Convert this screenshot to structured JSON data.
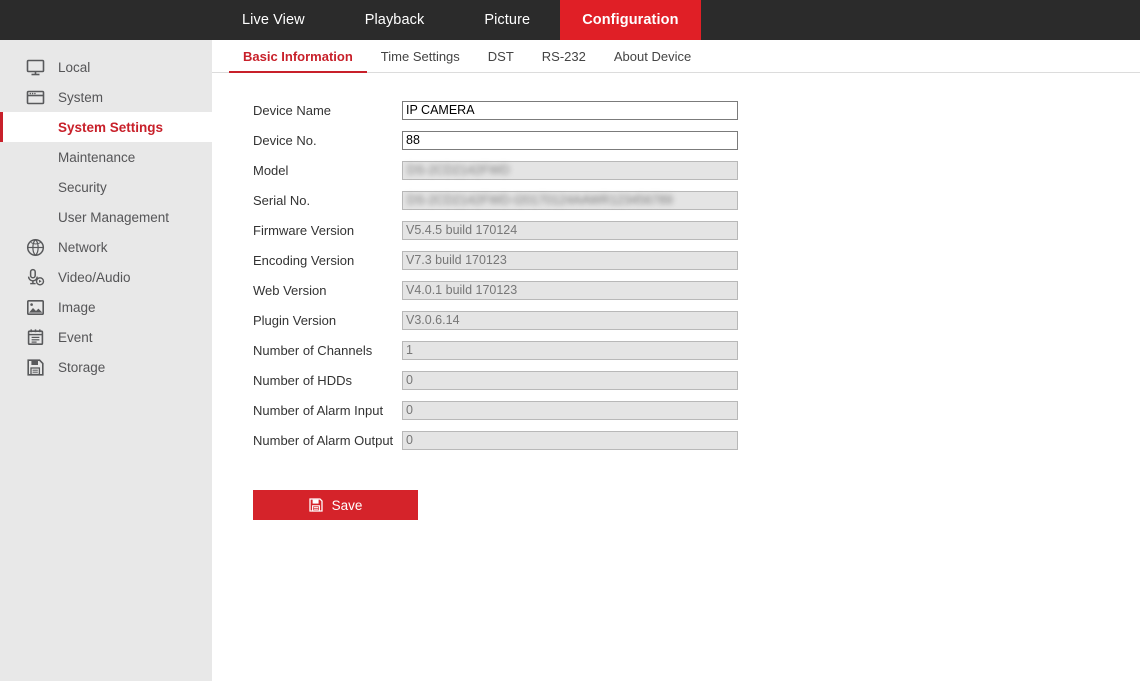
{
  "topnav": {
    "items": [
      {
        "label": "Live View",
        "active": false
      },
      {
        "label": "Playback",
        "active": false
      },
      {
        "label": "Picture",
        "active": false
      },
      {
        "label": "Configuration",
        "active": true
      }
    ],
    "background_color": "#2b2b2b",
    "active_color": "#e01f26"
  },
  "sidebar": {
    "background_color": "#e8e8e8",
    "active_color": "#c8202a",
    "items": [
      {
        "label": "Local",
        "icon": "monitor-icon",
        "level": "top"
      },
      {
        "label": "System",
        "icon": "window-icon",
        "level": "top"
      },
      {
        "label": "System Settings",
        "icon": "",
        "level": "sub",
        "active": true
      },
      {
        "label": "Maintenance",
        "icon": "",
        "level": "sub",
        "active": false
      },
      {
        "label": "Security",
        "icon": "",
        "level": "sub",
        "active": false
      },
      {
        "label": "User Management",
        "icon": "",
        "level": "sub",
        "active": false
      },
      {
        "label": "Network",
        "icon": "globe-icon",
        "level": "top"
      },
      {
        "label": "Video/Audio",
        "icon": "microphone-icon",
        "level": "top"
      },
      {
        "label": "Image",
        "icon": "picture-icon",
        "level": "top"
      },
      {
        "label": "Event",
        "icon": "calendar-icon",
        "level": "top"
      },
      {
        "label": "Storage",
        "icon": "floppy-disk-icon",
        "level": "top"
      }
    ]
  },
  "tabs": [
    {
      "label": "Basic Information",
      "active": true
    },
    {
      "label": "Time Settings",
      "active": false
    },
    {
      "label": "DST",
      "active": false
    },
    {
      "label": "RS-232",
      "active": false
    },
    {
      "label": "About Device",
      "active": false
    }
  ],
  "form": {
    "fields": [
      {
        "label": "Device Name",
        "value": "IP CAMERA",
        "disabled": false,
        "redacted": false
      },
      {
        "label": "Device No.",
        "value": "88",
        "disabled": false,
        "redacted": false
      },
      {
        "label": "Model",
        "value": "",
        "redacted_text": "DS-2CD2142FWD",
        "disabled": true,
        "redacted": true
      },
      {
        "label": "Serial No.",
        "value": "",
        "redacted_text": "DS-2CD2142FWD-I20170124AAWR123456789",
        "disabled": true,
        "redacted": true
      },
      {
        "label": "Firmware Version",
        "value": "V5.4.5 build 170124",
        "disabled": true,
        "redacted": false
      },
      {
        "label": "Encoding Version",
        "value": "V7.3 build 170123",
        "disabled": true,
        "redacted": false
      },
      {
        "label": "Web Version",
        "value": "V4.0.1 build 170123",
        "disabled": true,
        "redacted": false
      },
      {
        "label": "Plugin Version",
        "value": "V3.0.6.14",
        "disabled": true,
        "redacted": false
      },
      {
        "label": "Number of Channels",
        "value": "1",
        "disabled": true,
        "redacted": false
      },
      {
        "label": "Number of HDDs",
        "value": "0",
        "disabled": true,
        "redacted": false
      },
      {
        "label": "Number of Alarm Input",
        "value": "0",
        "disabled": true,
        "redacted": false
      },
      {
        "label": "Number of Alarm Output",
        "value": "0",
        "disabled": true,
        "redacted": false
      }
    ]
  },
  "save_button": {
    "label": "Save",
    "icon": "floppy-disk-icon",
    "color": "#d5232a"
  }
}
